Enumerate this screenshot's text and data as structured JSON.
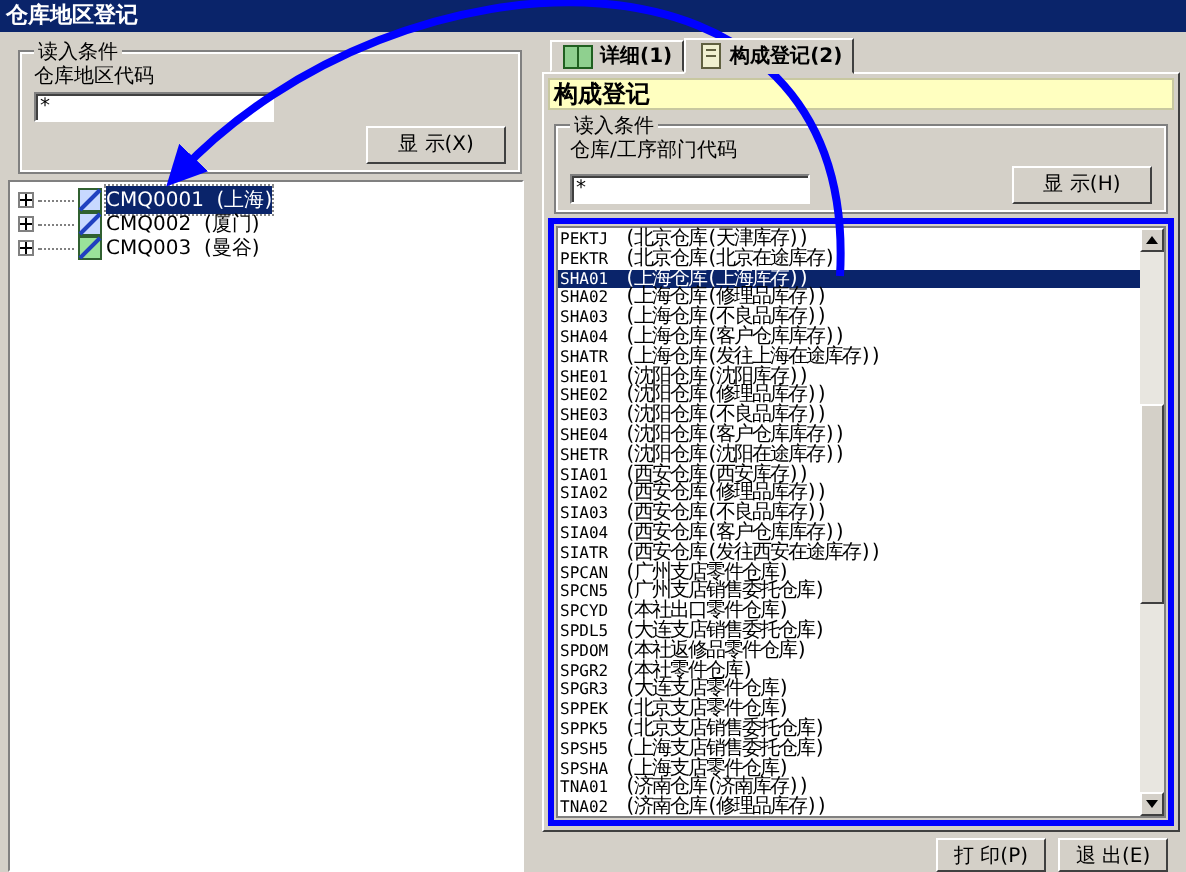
{
  "window": {
    "title": "仓库地区登记"
  },
  "left": {
    "group_title": "读入条件",
    "field_label": "仓库地区代码",
    "field_value": "*",
    "show_button": "显 示(X)",
    "tree": [
      {
        "code": "CMQ0001",
        "name": "(上海)",
        "selected": true,
        "expanded": false
      },
      {
        "code": "CMQ002",
        "name": "(厦门)",
        "selected": false,
        "expanded": false
      },
      {
        "code": "CMQ003",
        "name": "(曼谷)",
        "selected": false,
        "expanded": false
      }
    ]
  },
  "tabs": [
    {
      "label": "详细(1)",
      "selected": false,
      "kind": "book"
    },
    {
      "label": "构成登记(2)",
      "selected": true,
      "kind": "document"
    }
  ],
  "right": {
    "heading": "构成登记",
    "group_title": "读入条件",
    "field_label": "仓库/工序部门代码",
    "field_value": "*",
    "show_button": "显 示(H)",
    "list": [
      {
        "code": "PEKTJ",
        "name": "(北京仓库(天津库存))",
        "selected": false
      },
      {
        "code": "PEKTR",
        "name": "(北京仓库(北京在途库存))",
        "selected": false
      },
      {
        "code": "SHA01",
        "name": "(上海仓库(上海库存))",
        "selected": true
      },
      {
        "code": "SHA02",
        "name": "(上海仓库(修理品库存))",
        "selected": false
      },
      {
        "code": "SHA03",
        "name": "(上海仓库(不良品库存))",
        "selected": false
      },
      {
        "code": "SHA04",
        "name": "(上海仓库(客户仓库库存))",
        "selected": false
      },
      {
        "code": "SHATR",
        "name": "(上海仓库(发往上海在途库存))",
        "selected": false
      },
      {
        "code": "SHE01",
        "name": "(沈阳仓库(沈阳库存))",
        "selected": false
      },
      {
        "code": "SHE02",
        "name": "(沈阳仓库(修理品库存))",
        "selected": false
      },
      {
        "code": "SHE03",
        "name": "(沈阳仓库(不良品库存))",
        "selected": false
      },
      {
        "code": "SHE04",
        "name": "(沈阳仓库(客户仓库库存))",
        "selected": false
      },
      {
        "code": "SHETR",
        "name": "(沈阳仓库(沈阳在途库存))",
        "selected": false
      },
      {
        "code": "SIA01",
        "name": "(西安仓库(西安库存))",
        "selected": false
      },
      {
        "code": "SIA02",
        "name": "(西安仓库(修理品库存))",
        "selected": false
      },
      {
        "code": "SIA03",
        "name": "(西安仓库(不良品库存))",
        "selected": false
      },
      {
        "code": "SIA04",
        "name": "(西安仓库(客户仓库库存))",
        "selected": false
      },
      {
        "code": "SIATR",
        "name": "(西安仓库(发往西安在途库存))",
        "selected": false
      },
      {
        "code": "SPCAN",
        "name": "(广州支店零件仓库)",
        "selected": false
      },
      {
        "code": "SPCN5",
        "name": "(广州支店销售委托仓库)",
        "selected": false
      },
      {
        "code": "SPCYD",
        "name": "(本社出口零件仓库)",
        "selected": false
      },
      {
        "code": "SPDL5",
        "name": "(大连支店销售委托仓库)",
        "selected": false
      },
      {
        "code": "SPDOM",
        "name": "(本社返修品零件仓库)",
        "selected": false
      },
      {
        "code": "SPGR2",
        "name": "(本社零件仓库)",
        "selected": false
      },
      {
        "code": "SPGR3",
        "name": "(大连支店零件仓库)",
        "selected": false
      },
      {
        "code": "SPPEK",
        "name": "(北京支店零件仓库)",
        "selected": false
      },
      {
        "code": "SPPK5",
        "name": "(北京支店销售委托仓库)",
        "selected": false
      },
      {
        "code": "SPSH5",
        "name": "(上海支店销售委托仓库)",
        "selected": false
      },
      {
        "code": "SPSHA",
        "name": "(上海支店零件仓库)",
        "selected": false
      },
      {
        "code": "TNA01",
        "name": "(济南仓库(济南库存))",
        "selected": false
      },
      {
        "code": "TNA02",
        "name": "(济南仓库(修理品库存))",
        "selected": false
      }
    ]
  },
  "buttons": [
    "打 印(P)",
    "退 出(E)"
  ]
}
